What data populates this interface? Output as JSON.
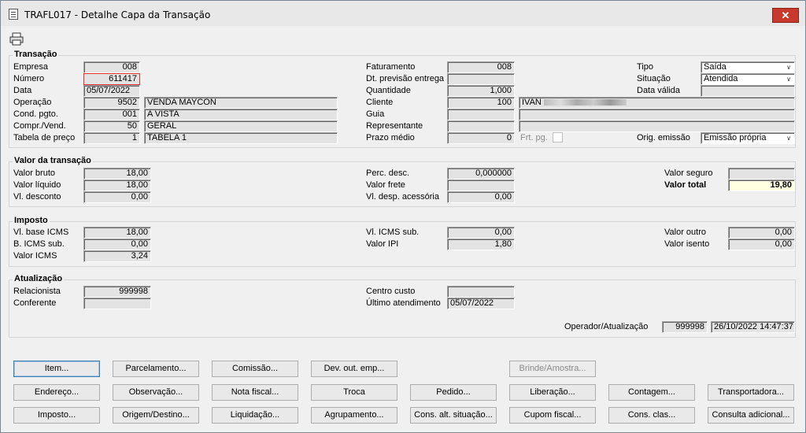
{
  "window": {
    "title": "TRAFL017 - Detalhe Capa da Transação",
    "close": "✕"
  },
  "transacao": {
    "legend": "Transação",
    "empresa_label": "Empresa",
    "empresa": "008",
    "numero_label": "Número",
    "numero": "611417",
    "data_label": "Data",
    "data": "05/07/2022",
    "operacao_label": "Operação",
    "operacao_cod": "9502",
    "operacao_desc": "VENDA MAYCON",
    "cond_label": "Cond. pgto.",
    "cond_cod": "001",
    "cond_desc": "A VISTA",
    "compr_label": "Compr./Vend.",
    "compr_cod": "50",
    "compr_desc": "GERAL",
    "tabela_label": "Tabela de preço",
    "tabela_cod": "1",
    "tabela_desc": "TABELA 1",
    "faturamento_label": "Faturamento",
    "faturamento": "008",
    "dtprev_label": "Dt. previsão entrega",
    "dtprev": "",
    "quantidade_label": "Quantidade",
    "quantidade": "1,000",
    "cliente_label": "Cliente",
    "cliente_cod": "100",
    "cliente_nome": "IVAN",
    "guia_label": "Guia",
    "representante_label": "Representante",
    "prazo_label": "Prazo médio",
    "prazo": "0",
    "frtpg_label": "Frt. pg.",
    "tipo_label": "Tipo",
    "tipo": "Saída",
    "situacao_label": "Situação",
    "situacao": "Atendida",
    "datavalida_label": "Data válida",
    "origem_label": "Orig. emissão",
    "origem": "Emissão própria"
  },
  "valor": {
    "legend": "Valor da transação",
    "bruto_label": "Valor bruto",
    "bruto": "18,00",
    "liquido_label": "Valor líquido",
    "liquido": "18,00",
    "desconto_label": "Vl. desconto",
    "desconto": "0,00",
    "percdesc_label": "Perc. desc.",
    "percdesc": "0,000000",
    "frete_label": "Valor frete",
    "despacess_label": "Vl. desp. acessória",
    "despacess": "0,00",
    "seguro_label": "Valor seguro",
    "total_label": "Valor total",
    "total": "19,80"
  },
  "imposto": {
    "legend": "Imposto",
    "baseicms_label": "Vl. base ICMS",
    "baseicms": "18,00",
    "bicmssub_label": "B. ICMS sub.",
    "bicmssub": "0,00",
    "valoricms_label": "Valor ICMS",
    "valoricms": "3,24",
    "icmssub_label": "Vl. ICMS sub.",
    "icmssub": "0,00",
    "ipi_label": "Valor IPI",
    "ipi": "1,80",
    "outro_label": "Valor outro",
    "outro": "0,00",
    "isento_label": "Valor isento",
    "isento": "0,00"
  },
  "atualizacao": {
    "legend": "Atualização",
    "relacionista_label": "Relacionista",
    "relacionista": "999998",
    "conferente_label": "Conferente",
    "centrocusto_label": "Centro custo",
    "ultimo_label": "Último atendimento",
    "ultimo": "05/07/2022",
    "operador_label": "Operador/Atualização",
    "operador": "999998",
    "operador_data": "26/10/2022 14:47:37"
  },
  "buttons": {
    "row1": [
      "Item...",
      "Parcelamento...",
      "Comissão...",
      "Dev. out. emp...",
      "Brinde/Amostra..."
    ],
    "row2": [
      "Endereço...",
      "Observação...",
      "Nota fiscal...",
      "Troca",
      "Pedido...",
      "Liberação...",
      "Contagem...",
      "Transportadora..."
    ],
    "row3": [
      "Imposto...",
      "Origem/Destino...",
      "Liquidação...",
      "Agrupamento...",
      "Cons. alt. situação...",
      "Cupom fiscal...",
      "Cons. clas...",
      "Consulta adicional..."
    ]
  }
}
